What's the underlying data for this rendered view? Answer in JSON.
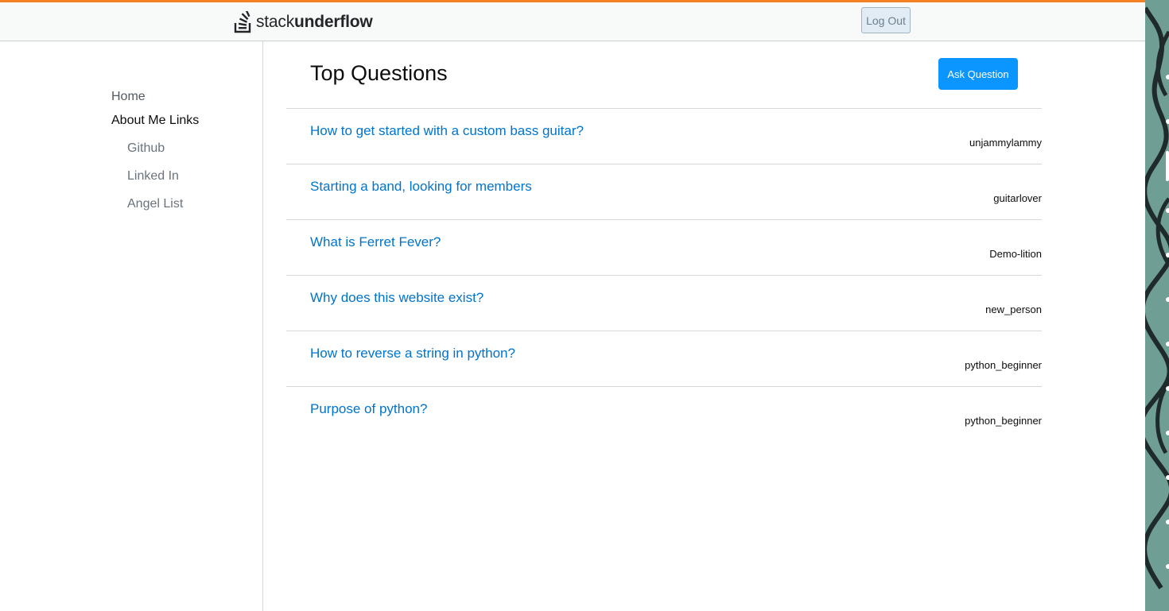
{
  "header": {
    "logo_light": "stack",
    "logo_bold": "underflow",
    "logout_label": "Log Out"
  },
  "sidebar": {
    "home": "Home",
    "about": "About Me Links",
    "links": [
      "Github",
      "Linked In",
      "Angel List"
    ]
  },
  "main": {
    "title": "Top Questions",
    "ask_label": "Ask Question",
    "questions": [
      {
        "title": "How to get started with a custom bass guitar?",
        "author": "unjammylammy"
      },
      {
        "title": "Starting a band, looking for members",
        "author": "guitarlover"
      },
      {
        "title": "What is Ferret Fever?",
        "author": "Demo-lition"
      },
      {
        "title": "Why does this website exist?",
        "author": "new_person"
      },
      {
        "title": "How to reverse a string in python?",
        "author": "python_beginner"
      },
      {
        "title": "Purpose of python?",
        "author": "python_beginner"
      }
    ]
  },
  "colors": {
    "accent_orange": "#f48225",
    "link_blue": "#0074cc",
    "button_blue": "#0a95ff",
    "desktop_teal": "#6f9e94"
  }
}
